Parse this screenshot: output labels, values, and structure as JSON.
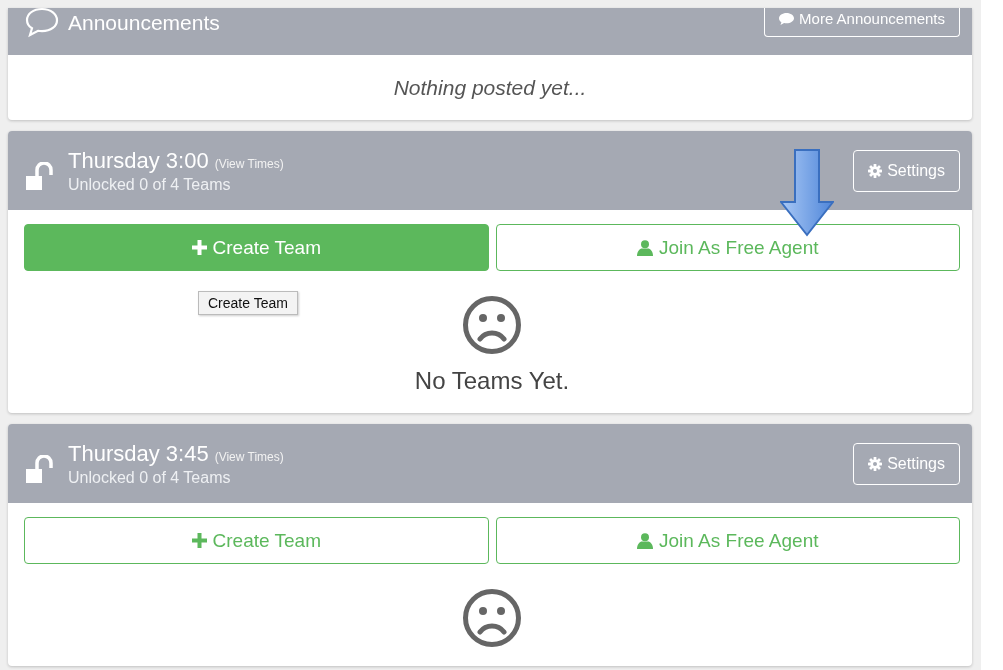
{
  "announcements": {
    "title": "Announcements",
    "button": "More Announcements",
    "empty_text": "Nothing posted yet..."
  },
  "timeslots": [
    {
      "title": "Thursday 3:00",
      "view_times": "(View Times)",
      "status": "Unlocked 0 of 4 Teams",
      "settings": "Settings",
      "create_button": {
        "label": "Create Team",
        "hovered": true,
        "tooltip": "Create Team"
      },
      "join_button": {
        "label": "Join As Free Agent",
        "hovered": false
      },
      "pointer_arrow": true,
      "empty_text": "No Teams Yet."
    },
    {
      "title": "Thursday 3:45",
      "view_times": "(View Times)",
      "status": "Unlocked 0 of 4 Teams",
      "settings": "Settings",
      "create_button": {
        "label": "Create Team",
        "hovered": false
      },
      "join_button": {
        "label": "Join As Free Agent",
        "hovered": false
      },
      "pointer_arrow": false
    }
  ]
}
